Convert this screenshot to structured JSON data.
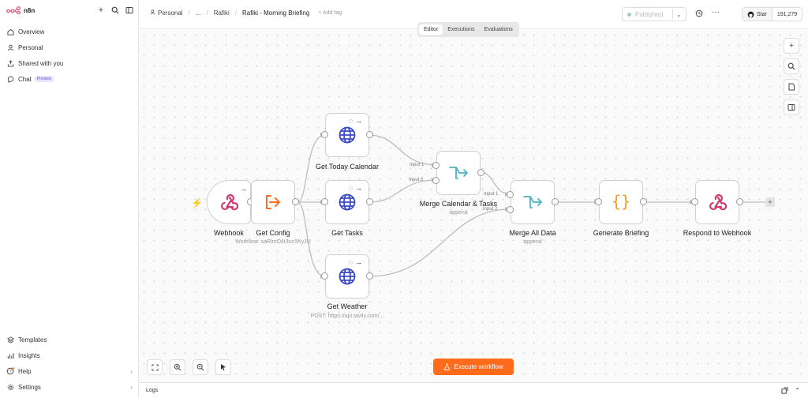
{
  "app": {
    "name": "n8n"
  },
  "sidebar": {
    "top_items": [
      {
        "label": "Overview",
        "icon": "home-icon"
      },
      {
        "label": "Personal",
        "icon": "user-icon"
      },
      {
        "label": "Shared with you",
        "icon": "share-icon"
      },
      {
        "label": "Chat",
        "icon": "chat-icon",
        "badge": "Preview"
      }
    ],
    "bottom_items": [
      {
        "label": "Templates",
        "icon": "templates-icon"
      },
      {
        "label": "Insights",
        "icon": "insights-icon"
      },
      {
        "label": "Help",
        "icon": "help-icon"
      },
      {
        "label": "Settings",
        "icon": "settings-icon"
      }
    ]
  },
  "header": {
    "breadcrumb": [
      "Personal",
      "...",
      "Rafiki"
    ],
    "workflow_name": "Rafiki - Morning Briefing",
    "add_tag": "+ Add tag",
    "publish_status": "Published",
    "github_star": "Star",
    "github_count": "191,279"
  },
  "tabs": [
    "Editor",
    "Executions",
    "Evaluations"
  ],
  "active_tab": "Editor",
  "nodes": {
    "webhook": {
      "label": "Webhook"
    },
    "get_config": {
      "label": "Get Config",
      "sub": "Workflow: saRlmO4t3uc5XyJU"
    },
    "get_today_calendar": {
      "label": "Get Today Calendar"
    },
    "get_tasks": {
      "label": "Get Tasks"
    },
    "get_weather": {
      "label": "Get Weather",
      "sub": "POST: https://api.tavily.com/..."
    },
    "merge_calendar_tasks": {
      "label": "Merge Calendar & Tasks",
      "sub": "append",
      "ports": [
        "Input 1",
        "Input 2"
      ]
    },
    "merge_all_data": {
      "label": "Merge All Data",
      "sub": "append",
      "ports": [
        "Input 1",
        "Input 2"
      ]
    },
    "generate_briefing": {
      "label": "Generate Briefing"
    },
    "respond_to_webhook": {
      "label": "Respond to Webhook"
    }
  },
  "canvas": {
    "execute_label": "Execute workflow"
  },
  "footer": {
    "logs_label": "Logs"
  },
  "colors": {
    "accent": "#ff6b1a",
    "webhook": "#d23a6e",
    "http": "#3a4bc6",
    "merge": "#4fb0c6",
    "code": "#f0a020"
  }
}
